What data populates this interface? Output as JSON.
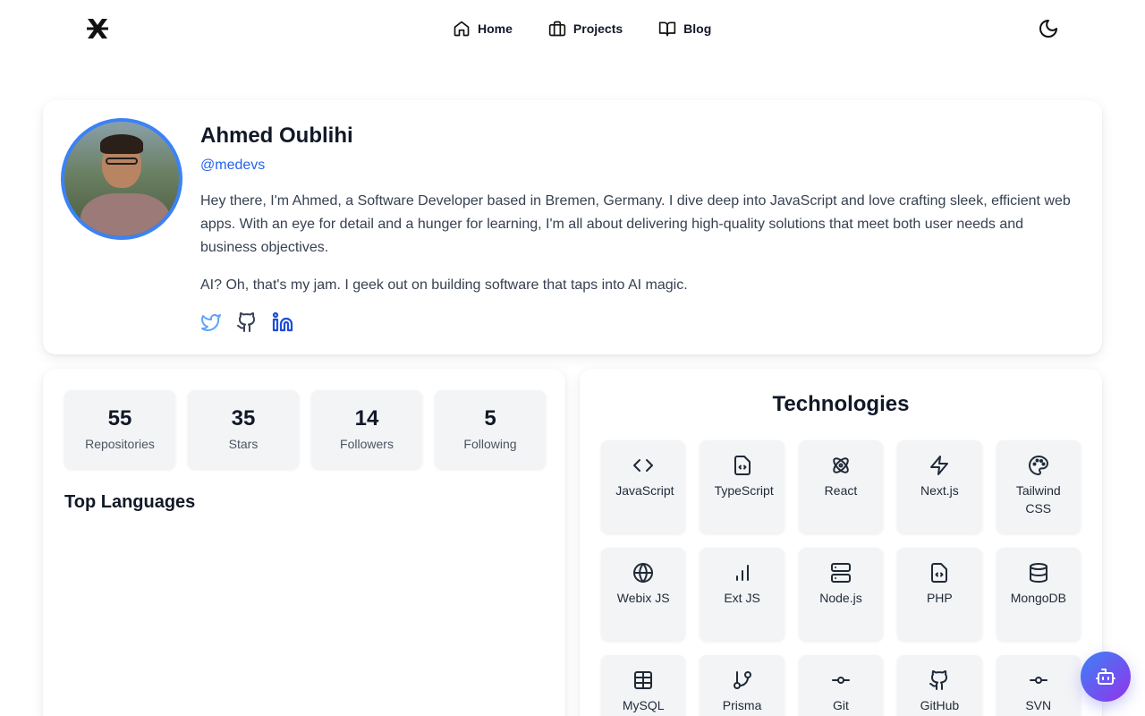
{
  "nav": {
    "logo": "logo-icon",
    "links": [
      {
        "label": "Home",
        "icon": "home-icon"
      },
      {
        "label": "Projects",
        "icon": "briefcase-icon"
      },
      {
        "label": "Blog",
        "icon": "book-open-icon"
      }
    ],
    "theme_toggle_icon": "moon-icon"
  },
  "profile": {
    "name": "Ahmed Oublihi",
    "handle": "@medevs",
    "bio": "Hey there, I'm Ahmed, a Software Developer based in Bremen, Germany. I dive deep into JavaScript and love crafting sleek, efficient web apps. With an eye for detail and a hunger for learning, I'm all about delivering high-quality solutions that meet both user needs and business objectives.",
    "bio_ai": "AI? Oh, that's my jam. I geek out on building software that taps into AI magic.",
    "socials": [
      {
        "icon": "twitter-icon",
        "color": "#60a5fa"
      },
      {
        "icon": "github-icon",
        "color": "#374151"
      },
      {
        "icon": "linkedin-icon",
        "color": "#1d4ed8"
      }
    ]
  },
  "stats": [
    {
      "value": "55",
      "label": "Repositories"
    },
    {
      "value": "35",
      "label": "Stars"
    },
    {
      "value": "14",
      "label": "Followers"
    },
    {
      "value": "5",
      "label": "Following"
    }
  ],
  "top_languages_title": "Top Languages",
  "technologies": {
    "title": "Technologies",
    "items": [
      {
        "label": "JavaScript",
        "icon": "code-icon"
      },
      {
        "label": "TypeScript",
        "icon": "file-code-icon"
      },
      {
        "label": "React",
        "icon": "atom-icon"
      },
      {
        "label": "Next.js",
        "icon": "zap-icon"
      },
      {
        "label": "Tailwind CSS",
        "icon": "palette-icon"
      },
      {
        "label": "Webix JS",
        "icon": "globe-icon"
      },
      {
        "label": "Ext JS",
        "icon": "bar-chart-icon"
      },
      {
        "label": "Node.js",
        "icon": "server-icon"
      },
      {
        "label": "PHP",
        "icon": "file-code-icon"
      },
      {
        "label": "MongoDB",
        "icon": "database-icon"
      },
      {
        "label": "MySQL",
        "icon": "table-icon"
      },
      {
        "label": "Prisma",
        "icon": "git-branch-icon"
      },
      {
        "label": "Git",
        "icon": "git-commit-icon"
      },
      {
        "label": "GitHub",
        "icon": "github-icon"
      },
      {
        "label": "SVN",
        "icon": "git-commit-icon"
      }
    ]
  },
  "chat_button_icon": "bot-icon",
  "colors": {
    "accent": "#2563eb",
    "avatar_ring": "#3b82f6",
    "card_bg": "#f3f4f6"
  }
}
